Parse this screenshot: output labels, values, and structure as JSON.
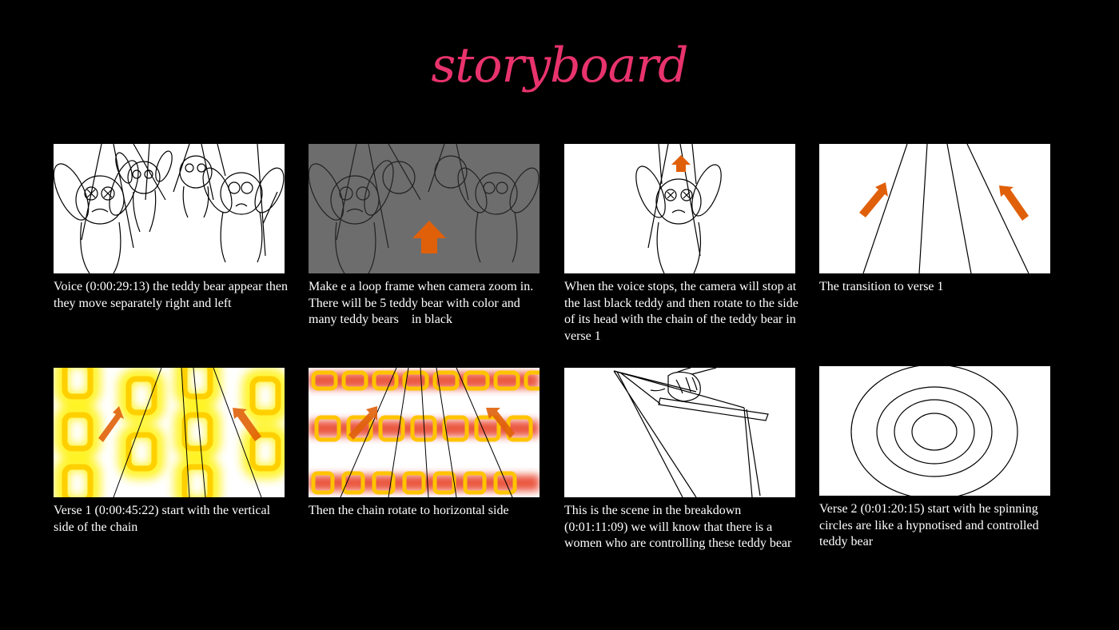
{
  "title": "storyboard",
  "accent_color": "#e8336d",
  "arrow_color": "#e0600a",
  "frames": [
    {
      "scene": "teddy-bears-hanging",
      "caption": "Voice (0:00:29:13) the teddy bear appear then they move separately right and left"
    },
    {
      "scene": "teddy-bears-loop-gray",
      "caption": "Make e a loop frame when camera zoom in. There will be 5 teddy bear with color and many teddy bears    in black"
    },
    {
      "scene": "single-teddy-bear",
      "caption": "When the voice stops, the camera will stop at the last black teddy and then rotate to the side of its head with the chain of the teddy bear in  verse 1"
    },
    {
      "scene": "transition-lines",
      "caption": "The transition to verse 1"
    },
    {
      "scene": "vertical-chain",
      "caption": "Verse 1 (0:00:45:22) start with the vertical side of the chain"
    },
    {
      "scene": "horizontal-chain",
      "caption": "Then the chain rotate to horizontal side"
    },
    {
      "scene": "puppeteer-hand",
      "caption": "This is the scene in the breakdown (0:01:11:09) we will know that there is a women who are controlling these teddy bear"
    },
    {
      "scene": "hypnotic-circles",
      "caption": "Verse 2 (0:01:20:15) start with he spinning circles are like a hypnotised and controlled teddy bear"
    }
  ]
}
